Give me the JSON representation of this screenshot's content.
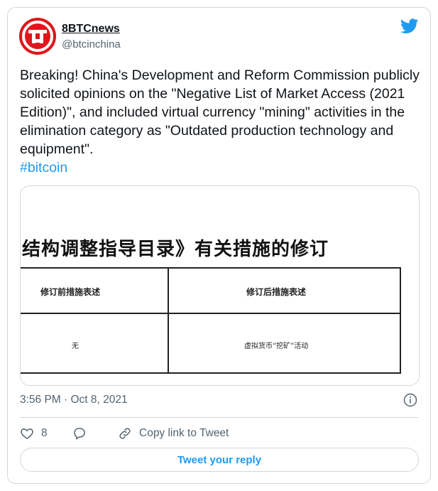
{
  "tweet": {
    "author_name": "8BTCnews",
    "author_handle": "@btcinchina",
    "text": "Breaking! China's Development and Reform Commission publicly solicited opinions on the \"Negative List of Market Access (2021 Edition)\", and included virtual currency \"mining\" activities in the elimination category as \"Outdated production technology and equipment\".",
    "hashtag": "#bitcoin",
    "timestamp": "3:56 PM · Oct 8, 2021",
    "like_count": "8",
    "copy_link_label": "Copy link to Tweet",
    "reply_label": "Tweet your reply"
  },
  "media": {
    "doc_title": "结构调整指导目录》有关措施的修订",
    "header_left": "修订前措施表述",
    "header_right": "修订后措施表述",
    "cell_left": "无",
    "cell_right": "虚拟货币“挖矿”活动"
  },
  "colors": {
    "accent": "#1d9bf0",
    "avatar_bg": "#e0161b",
    "muted_text": "#536471",
    "border": "#cfd9de"
  },
  "icons": {
    "platform": "twitter-bird-icon",
    "info": "info-icon",
    "like": "heart-icon",
    "reply": "speech-bubble-icon",
    "link": "link-icon"
  }
}
